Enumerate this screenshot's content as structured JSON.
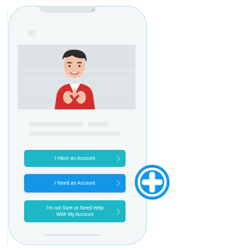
{
  "buttons": {
    "have_account": "I Have an Account",
    "need_account": "I Need an Account",
    "help_line1": "I'm not Sure or Need Help",
    "help_line2": "With My Account"
  },
  "icons": {
    "menu": "hamburger-menu-icon",
    "plus": "plus-badge-icon",
    "chevron": "chevron-right-icon"
  },
  "colors": {
    "accent": "#1db8c6",
    "primary": "#1496e8",
    "badge": "#1496e8",
    "phone_outline": "#b9e6f4"
  }
}
